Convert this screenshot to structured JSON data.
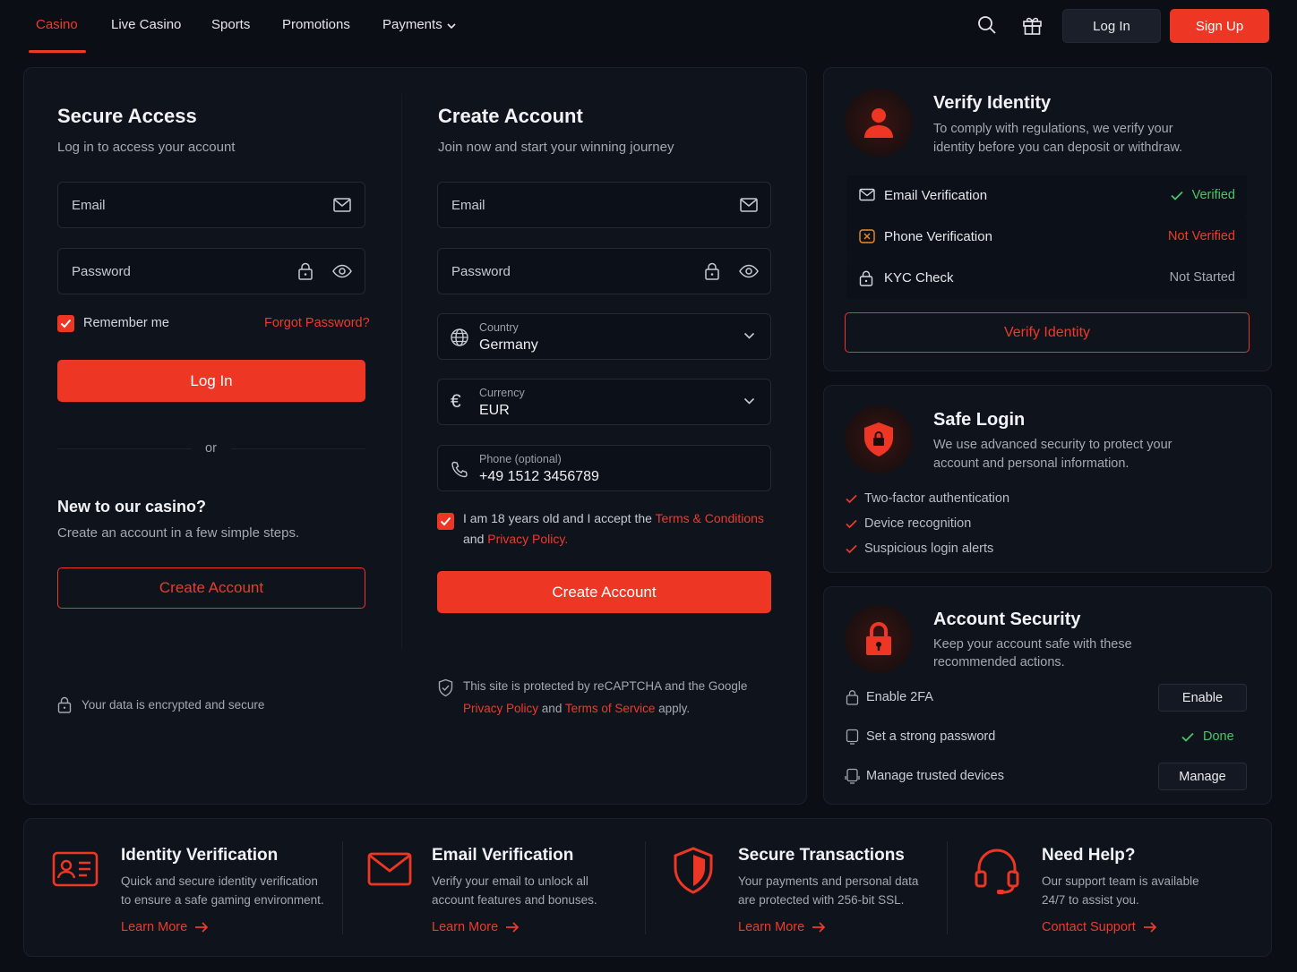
{
  "nav": {
    "items": [
      "Casino",
      "Live Casino",
      "Sports",
      "Promotions",
      "Payments"
    ],
    "login": "Log In",
    "signup": "Sign Up"
  },
  "login": {
    "title": "Secure Access",
    "subtitle": "Log in to access your account",
    "email_placeholder": "Email",
    "password_placeholder": "Password",
    "remember": "Remember me",
    "forgot": "Forgot Password?",
    "button": "Log In",
    "or": "or",
    "new_title": "New to our casino?",
    "new_sub": "Create an account in a few simple steps.",
    "create_button": "Create Account",
    "secure_note": "Your data is encrypted and secure"
  },
  "register": {
    "title": "Create Account",
    "subtitle": "Join now and start your winning journey",
    "email_placeholder": "Email",
    "password_placeholder": "Password",
    "country_label": "Country",
    "country_value": "Germany",
    "currency_label": "Currency",
    "currency_value": "EUR",
    "phone_label": "Phone (optional)",
    "phone_value": "+49 1512 3456789",
    "terms_prefix": "I am 18 years old and I accept the",
    "terms_link": "Terms & Conditions",
    "terms_and": "and",
    "privacy_link": "Privacy Policy",
    "terms_end": ".",
    "button": "Create Account",
    "recaptcha_line1": "This site is protected by reCAPTCHA and the Google",
    "recaptcha_privacy": "Privacy Policy",
    "recaptcha_and": "and",
    "recaptcha_terms": "Terms of Service",
    "recaptcha_apply": "apply."
  },
  "verify": {
    "title": "Verify Identity",
    "desc1": "To comply with regulations, we verify your",
    "desc2": "identity before you can deposit or withdraw.",
    "rows": [
      {
        "label": "Email Verification",
        "status": "Verified",
        "color": "#4cc46a"
      },
      {
        "label": "Phone Verification",
        "status": "Not Verified",
        "color": "#ef3a2b"
      },
      {
        "label": "KYC Check",
        "status": "Not Started",
        "color": "#a3a8b2"
      }
    ],
    "button": "Verify Identity"
  },
  "safe": {
    "title": "Safe Login",
    "desc1": "We use advanced security to protect your",
    "desc2": "account and personal information.",
    "items": [
      "Two-factor authentication",
      "Device recognition",
      "Suspicious login alerts"
    ]
  },
  "security": {
    "title": "Account Security",
    "desc1": "Keep your account safe with these",
    "desc2": "recommended actions.",
    "rows": [
      {
        "label": "Enable 2FA",
        "action": "Enable"
      },
      {
        "label": "Set a strong password",
        "action": "Done"
      },
      {
        "label": "Manage trusted devices",
        "action": "Manage"
      }
    ]
  },
  "footer": [
    {
      "title": "Identity Verification",
      "l1": "Quick and secure identity verification",
      "l2": "to ensure a safe gaming environment.",
      "link": "Learn More"
    },
    {
      "title": "Email Verification",
      "l1": "Verify your email to unlock all",
      "l2": "account features and bonuses.",
      "link": "Learn More"
    },
    {
      "title": "Secure Transactions",
      "l1": "Your payments and personal data",
      "l2": "are protected with 256-bit SSL.",
      "link": "Learn More"
    },
    {
      "title": "Need Help?",
      "l1": "Our support team is available",
      "l2": "24/7 to assist you.",
      "link": "Contact Support"
    }
  ],
  "colors": {
    "accent": "#ee3624",
    "success": "#4cc46a",
    "bg": "#0b0e15",
    "panel": "#0f131c"
  }
}
